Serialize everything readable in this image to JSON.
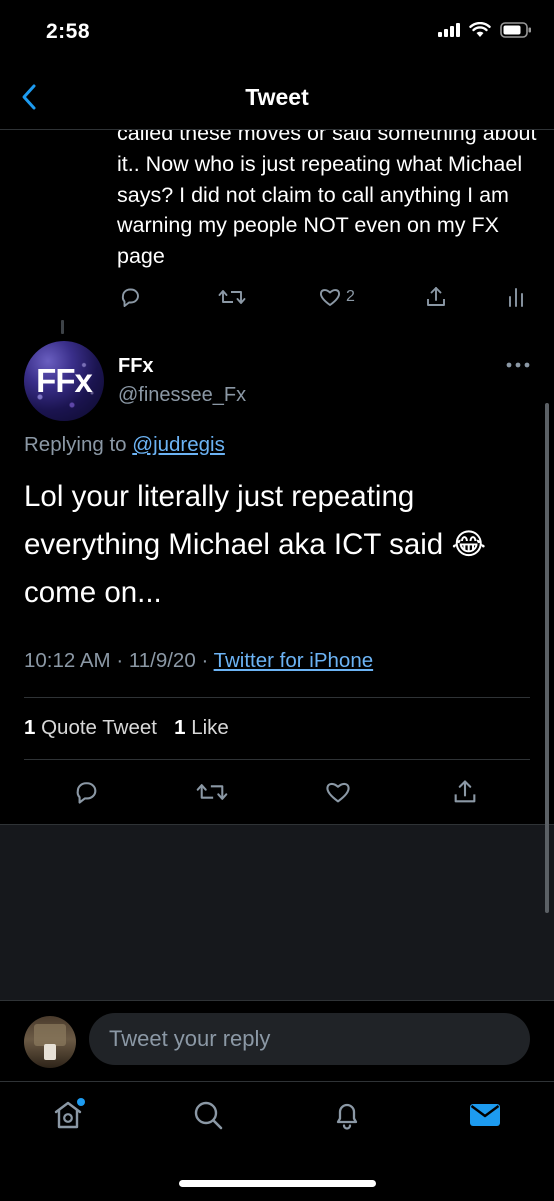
{
  "status_bar": {
    "time": "2:58"
  },
  "nav": {
    "title": "Tweet"
  },
  "parent_tweet": {
    "text": "called these moves or said something about it.. Now who is just repeating what Michael says? I did not claim to call anything I am warning my people NOT even on my FX page",
    "like_count": "2"
  },
  "tweet": {
    "avatar_text": "FFx",
    "display_name": "FFx",
    "handle": "@finessee_Fx",
    "replying_prefix": "Replying to",
    "replying_to": "@judregis",
    "body": "Lol your literally just repeating everything Michael aka ICT said 😂 come on...",
    "time": "10:12 AM",
    "date": "11/9/20",
    "source": "Twitter for iPhone",
    "quote_count": "1",
    "quote_label": "Quote Tweet",
    "like_count": "1",
    "like_label": "Like"
  },
  "reply": {
    "placeholder": "Tweet your reply"
  },
  "tabs": [
    "home",
    "search",
    "notifications",
    "messages"
  ],
  "colors": {
    "accent": "#1d9bf0",
    "link": "#6cb3f4",
    "secondary_text": "#8b98a5",
    "background": "#000000"
  }
}
